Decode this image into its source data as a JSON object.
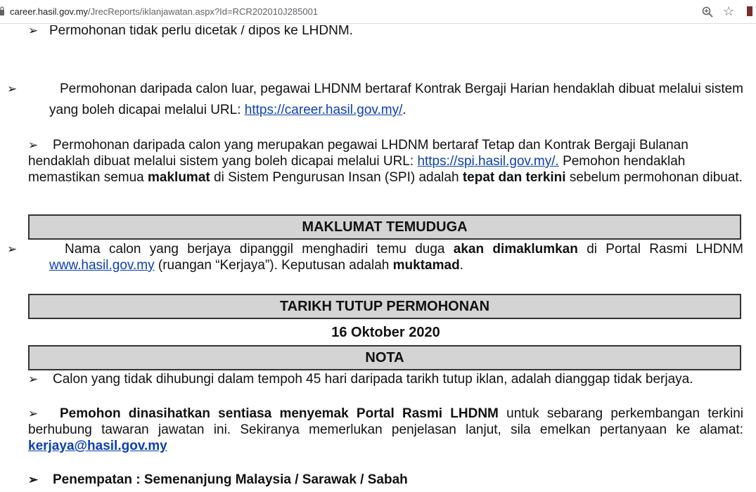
{
  "browser": {
    "url_host": "career.hasil.gov.my",
    "url_path": "/JrecReports/iklanjawatan.aspx?Id=RCR202010J285001"
  },
  "doc": {
    "arrow": "➢",
    "p1": "Permohonan tidak perlu dicetak / dipos ke LHDNM.",
    "p2_text": "Permohonan daripada calon luar, pegawai LHDNM bertaraf Kontrak Bergaji Harian hendaklah dibuat melalui sistem yang boleh dicapai melalui URL:",
    "p2_link": "https://career.hasil.gov.my/",
    "p3_text1": "Permohonan daripada calon yang merupakan pegawai LHDNM bertaraf Tetap dan Kontrak Bergaji Bulanan hendaklah dibuat melalui sistem yang boleh dicapai melalui URL:",
    "p3_link": "https://spi.hasil.gov.my/.",
    "p3_text2": "Pemohon hendaklah memastikan semua",
    "p3_bold1": "maklumat",
    "p3_text3": "di Sistem Pengurusan Insan (SPI) adalah",
    "p3_bold2": "tepat dan terkini",
    "p3_text4": "sebelum permohonan dibuat.",
    "h_temuduga": "MAKLUMAT TEMUDUGA",
    "p4_text1": "Nama calon yang berjaya dipanggil menghadiri temu duga",
    "p4_bold1": "akan dimaklumkan",
    "p4_text2": "di Portal Rasmi LHDNM",
    "p4_link": "www.hasil.gov.my",
    "p4_text3": "(ruangan “Kerjaya”). Keputusan adalah",
    "p4_bold2": "muktamad",
    "h_tutup": "TARIKH TUTUP PERMOHONAN",
    "tarikh": "16 Oktober 2020",
    "h_nota": "NOTA",
    "p5": "Calon yang tidak dihubungi dalam tempoh 45 hari daripada tarikh tutup iklan, adalah dianggap tidak berjaya.",
    "p6_bold": "Pemohon dinasihatkan sentiasa menyemak Portal Rasmi LHDNM",
    "p6_text": "untuk sebarang perkembangan terkini berhubung tawaran jawatan ini. Sekiranya memerlukan penjelasan lanjut, sila emelkan pertanyaan ke alamat:",
    "p6_email": "kerjaya@hasil.gov.my",
    "p7": "Penempatan : Semenanjung Malaysia / Sarawak / Sabah"
  }
}
